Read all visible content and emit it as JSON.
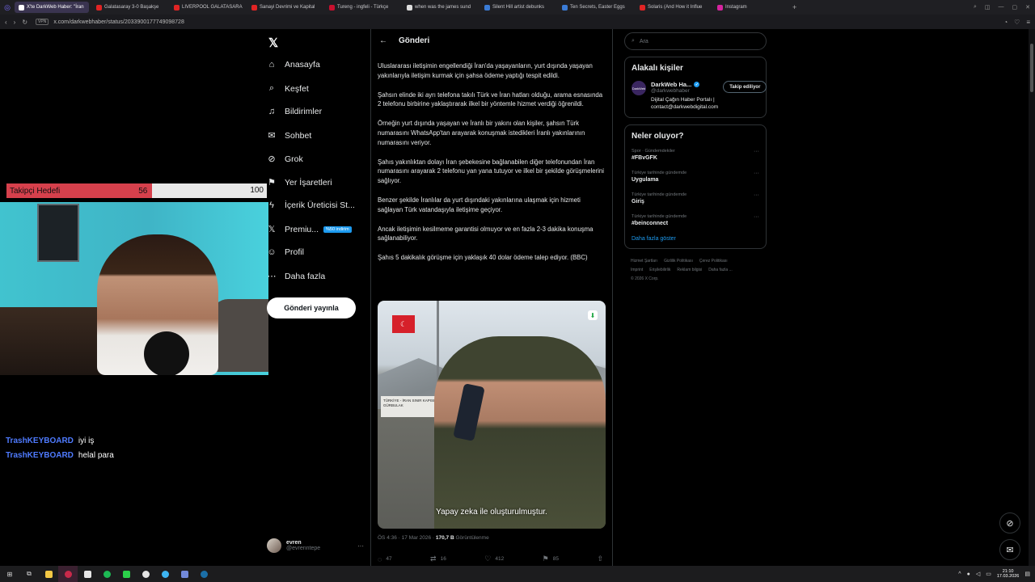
{
  "browser": {
    "tabs": [
      {
        "label": "X'te DarkWeb Haber: \"İran",
        "color": "#ffffff",
        "active": true
      },
      {
        "label": "Galatasaray 3-0 Başakşe",
        "color": "#e02424"
      },
      {
        "label": "LIVERPOOL GALATASARA",
        "color": "#e02424"
      },
      {
        "label": "Sanayi Devrimi ve Kapital",
        "color": "#e02424"
      },
      {
        "label": "Tureng - ingfeli - Türkçe",
        "color": "#c8102e"
      },
      {
        "label": "when was the james sund",
        "color": "#dddddd"
      },
      {
        "label": "Silent Hill artist debunks",
        "color": "#3a7bd5"
      },
      {
        "label": "Ten Secrets, Easter Eggs",
        "color": "#3a7bd5"
      },
      {
        "label": "Solaris (And How it Influe",
        "color": "#e02424"
      },
      {
        "label": "Instagram",
        "color": "#d6249f"
      }
    ],
    "new_tab": "+",
    "url": "x.com/darkwebhaber/status/2033900177749098728",
    "shield_label": "VPN"
  },
  "overlay": {
    "goal_label": "Takipçi Hedefi",
    "current": "56",
    "target": "100",
    "progress_fraction": 0.56
  },
  "chat": [
    {
      "user": "TrashKEYBOARD",
      "message": "iyi iş"
    },
    {
      "user": "TrashKEYBOARD",
      "message": "helal para"
    }
  ],
  "nav": {
    "logo": "𝕏",
    "items": [
      {
        "label": "Anasayfa",
        "icon": "home-icon",
        "glyph": "⌂"
      },
      {
        "label": "Keşfet",
        "icon": "search-icon",
        "glyph": "⌕"
      },
      {
        "label": "Bildirimler",
        "icon": "bell-icon",
        "glyph": "♫"
      },
      {
        "label": "Sohbet",
        "icon": "mail-icon",
        "glyph": "✉"
      },
      {
        "label": "Grok",
        "icon": "grok-icon",
        "glyph": "⊘"
      },
      {
        "label": "Yer İşaretleri",
        "icon": "bookmark-icon",
        "glyph": "⚑"
      },
      {
        "label": "İçerik Üreticisi St...",
        "icon": "lightning-icon",
        "glyph": "ϟ"
      },
      {
        "label": "Premiu...",
        "icon": "x-premium-icon",
        "glyph": "𝕏",
        "badge": "%50 indirim"
      },
      {
        "label": "Profil",
        "icon": "person-icon",
        "glyph": "☺"
      },
      {
        "label": "Daha fazla",
        "icon": "more-circle-icon",
        "glyph": "⋯"
      }
    ],
    "post_button": "Gönderi yayınla",
    "account_name": "evren",
    "account_handle": "@evrenntepe"
  },
  "post": {
    "header": "Gönderi",
    "paragraphs": [
      "Uluslararası iletişimin engellendiği İran'da yaşayanların, yurt dışında yaşayan yakınlarıyla iletişim kurmak için şahsa ödeme yaptığı tespit edildi.",
      "Şahsın elinde iki ayrı telefona takılı Türk ve İran hatları olduğu, arama esnasında 2 telefonu birbirine yaklaştırarak ilkel bir yöntemle hizmet verdiği öğrenildi.",
      "Örneğin yurt dışında yaşayan ve İranlı bir yakını olan kişiler, şahsın Türk numarasını WhatsApp'tan arayarak konuşmak istedikleri İranlı yakınlarının numarasını veriyor.",
      "Şahıs yakınlıktan dolayı İran şebekesine bağlanabilen diğer telefonundan İran numarasını arayarak 2 telefonu yan yana tutuyor ve ilkel bir şekilde görüşmelerini sağlıyor.",
      "Benzer şekilde İranlılar da yurt dışındaki yakınlarına ulaşmak için hizmeti sağlayan Türk vatandaşıyla iletişime geçiyor.",
      "Ancak iletişimin kesilmeme garantisi olmuyor ve en fazla 2-3 dakika konuşma sağlanabiliyor.",
      "Şahıs 5 dakikalık görüşme için yaklaşık 40 dolar ödeme talep ediyor. (BBC)"
    ],
    "image_caption": "Yapay zeka ile oluşturulmuştur.",
    "sign_text": "TÜRKİYE - İRAN SINIR KAPISI GÜRBULAK",
    "timestamp": "ÖS 4:36 · 17 Mar 2026 · ",
    "views_count": "170,7 B",
    "views_label": " Görüntülenme",
    "actions": [
      {
        "icon": "reply-icon",
        "glyph": "◌",
        "count": "47"
      },
      {
        "icon": "repost-icon",
        "glyph": "⇄",
        "count": "16"
      },
      {
        "icon": "like-icon",
        "glyph": "♡",
        "count": "412"
      },
      {
        "icon": "bookmark-icon",
        "glyph": "⚑",
        "count": "85"
      },
      {
        "icon": "share-icon",
        "glyph": "⇧",
        "count": ""
      }
    ]
  },
  "sidebar": {
    "search_placeholder": "Ara",
    "related_title": "Alakalı kişiler",
    "related": {
      "avatar_text": "DarkWeb",
      "name": "DarkWeb Ha...",
      "handle": "@darkwebhaber",
      "bio_line1": "Dijital Çağın Haber Portalı |",
      "bio_line2": "contact@darkwebdigital.com",
      "follow_label": "Takip ediliyor"
    },
    "trends_title": "Neler oluyor?",
    "trends": [
      {
        "context": "Spor · Gündemdekiler",
        "title": "#FBvGFK"
      },
      {
        "context": "Türkiye tarihinde gündemde",
        "title": "Uygulama"
      },
      {
        "context": "Türkiye tarihinde gündemde",
        "title": "Giriş"
      },
      {
        "context": "Türkiye tarihinde gündemde",
        "title": "#beinconnect"
      }
    ],
    "show_more": "Daha fazla göster",
    "footer_links": [
      "Hizmet Şartları",
      "Gizlilik Politikası",
      "Çerez Politikası",
      "Imprint",
      "Erişilebilirlik",
      "Reklam bilgisi",
      "Daha fazla ..."
    ],
    "copyright": "© 2026 X Corp."
  },
  "taskbar": {
    "time": "21:10",
    "date": "17.03.2026"
  }
}
